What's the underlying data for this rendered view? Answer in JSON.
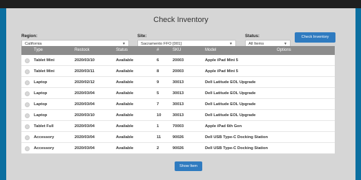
{
  "page": {
    "title": "Check Inventory"
  },
  "filters": {
    "region_label": "Region:",
    "region_value": "California",
    "site_label": "Site:",
    "site_value": "Sacramento FFO [001]",
    "status_label": "Status:",
    "status_value": "All Items",
    "check_button": "Check Inventory"
  },
  "table": {
    "headers": {
      "type": "Type",
      "restock": "Restock",
      "status": "Status",
      "num": "#",
      "sku": "SKU",
      "model": "Model",
      "options": "Options"
    },
    "rows": [
      {
        "type": "Tablet Mini",
        "restock": "2020/03/10",
        "status": "Available",
        "num": "6",
        "sku": "20003",
        "model": "Apple iPad Mini 5"
      },
      {
        "type": "Tablet Mini",
        "restock": "2020/03/11",
        "status": "Available",
        "num": "8",
        "sku": "20003",
        "model": "Apple iPad Mini 5"
      },
      {
        "type": "Laptop",
        "restock": "2020/02/12",
        "status": "Available",
        "num": "9",
        "sku": "30013",
        "model": "Dell Latitude EOL Upgrade"
      },
      {
        "type": "Laptop",
        "restock": "2020/03/04",
        "status": "Available",
        "num": "5",
        "sku": "30013",
        "model": "Dell Latitude EOL Upgrade"
      },
      {
        "type": "Laptop",
        "restock": "2020/03/04",
        "status": "Available",
        "num": "7",
        "sku": "30013",
        "model": "Dell Latitude EOL Upgrade"
      },
      {
        "type": "Laptop",
        "restock": "2020/03/10",
        "status": "Available",
        "num": "10",
        "sku": "30013",
        "model": "Dell Latitude EOL Upgrade"
      },
      {
        "type": "Tablet Full",
        "restock": "2020/03/04",
        "status": "Available",
        "num": "1",
        "sku": "70003",
        "model": "Apple iPad 6th Gen"
      },
      {
        "type": "Accessory",
        "restock": "2020/03/04",
        "status": "Available",
        "num": "11",
        "sku": "90026",
        "model": "Dell USB Type-C Docking Station"
      },
      {
        "type": "Accessory",
        "restock": "2020/03/04",
        "status": "Available",
        "num": "2",
        "sku": "90026",
        "model": "Dell USB Type-C Docking Station"
      }
    ]
  },
  "show_button": "Show Item"
}
